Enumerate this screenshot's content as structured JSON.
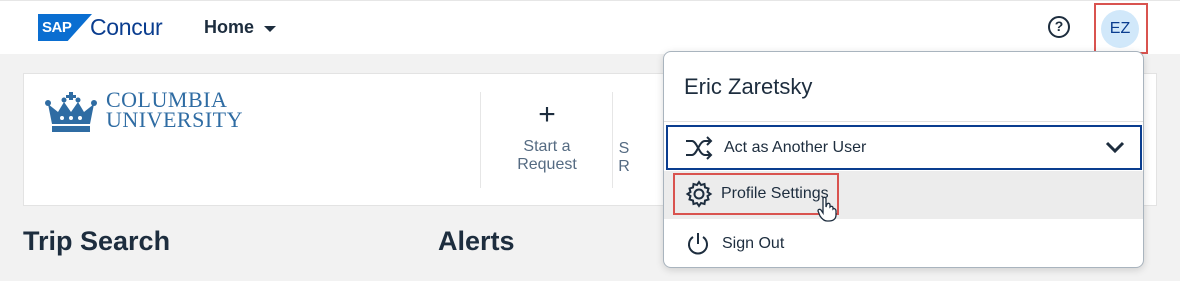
{
  "brand": {
    "sap": "SAP",
    "name": "Concur"
  },
  "nav": {
    "home_label": "Home"
  },
  "header": {
    "help_glyph": "?",
    "avatar_initials": "EZ"
  },
  "org": {
    "line1": "COLUMBIA",
    "line2": "UNIVERSITY"
  },
  "actions": [
    {
      "glyph": "+",
      "line1": "Start a",
      "line2": "Request"
    },
    {
      "line1": "S",
      "line2": "R"
    }
  ],
  "sections": {
    "trip_search": "Trip Search",
    "alerts": "Alerts"
  },
  "user_menu": {
    "name": "Eric Zaretsky",
    "act_as": "Act as Another User",
    "profile_settings": "Profile Settings",
    "sign_out": "Sign Out"
  },
  "colors": {
    "accent": "#0a3d8f",
    "brand_blue": "#0a6ed1",
    "highlight": "#d9534f"
  },
  "icons": [
    "help-icon",
    "chevron-down-icon",
    "shuffle-icon",
    "gear-icon",
    "power-icon",
    "crown-icon",
    "plus-icon",
    "hand-cursor-icon"
  ]
}
